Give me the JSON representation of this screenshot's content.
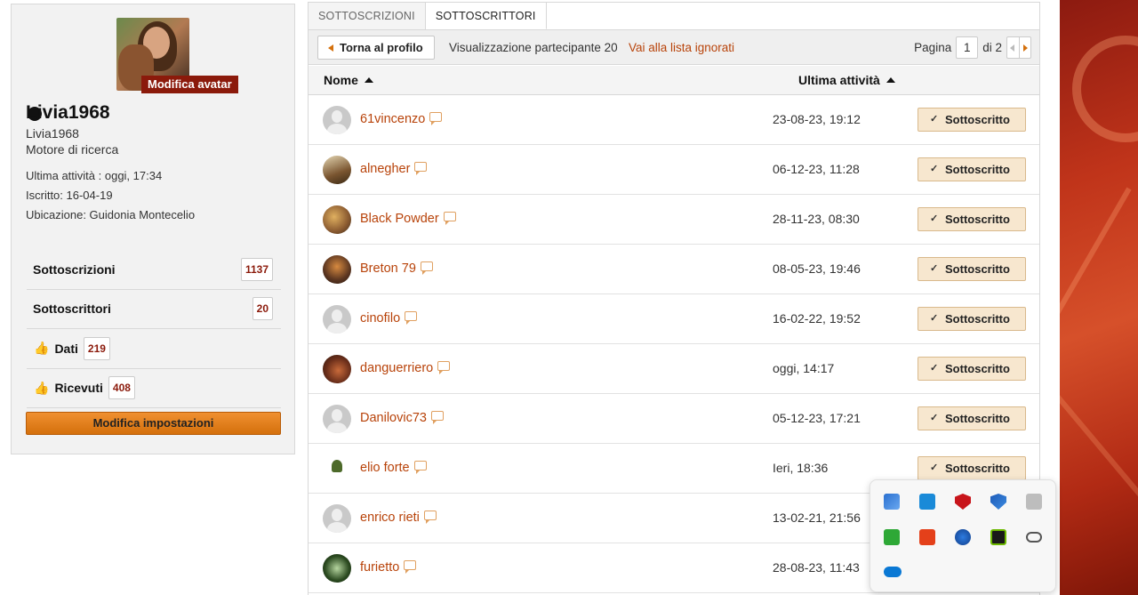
{
  "profile": {
    "edit_avatar": "Modifica avatar",
    "username_display": "Livia1968",
    "username": "Livia1968",
    "rank": "Motore di ricerca",
    "last_activity": "Ultima attività  : oggi, 17:34",
    "joined": "Iscritto: 16-04-19",
    "location": "Ubicazione: Guidonia Montecelio"
  },
  "stats": {
    "subscriptions_label": "Sottoscrizioni",
    "subscriptions_count": "1137",
    "subscribers_label": "Sottoscrittori",
    "subscribers_count": "20",
    "given_label": "Dati",
    "given_count": "219",
    "received_label": "Ricevuti",
    "received_count": "408",
    "settings_button": "Modifica impostazioni"
  },
  "tabs": [
    "SOTTOSCRIZIONI",
    "SOTTOSCRITTORI"
  ],
  "toolbar": {
    "back_button": "Torna al profilo",
    "viewing": "Visualizzazione partecipante 20",
    "ignored_link": "Vai alla lista ignorati",
    "page_label": "Pagina",
    "page_value": "1",
    "page_of": "di 2"
  },
  "table": {
    "col_name": "Nome",
    "col_activity": "Ultima attività",
    "rows": [
      {
        "name": "61vincenzo",
        "date": "23-08-23, 19:12",
        "status": "Sottoscritto"
      },
      {
        "name": "alnegher",
        "date": "06-12-23, 11:28",
        "status": "Sottoscritto"
      },
      {
        "name": "Black Powder",
        "date": "28-11-23, 08:30",
        "status": "Sottoscritto"
      },
      {
        "name": "Breton 79",
        "date": "08-05-23, 19:46",
        "status": "Sottoscritto"
      },
      {
        "name": "cinofilo",
        "date": "16-02-22, 19:52",
        "status": "Sottoscritto"
      },
      {
        "name": "danguerriero",
        "date": "oggi, 14:17",
        "status": "Sottoscritto"
      },
      {
        "name": "Danilovic73",
        "date": "05-12-23, 17:21",
        "status": "Sottoscritto"
      },
      {
        "name": "elio forte",
        "date": "Ieri, 18:36",
        "status": "Sottoscritto"
      },
      {
        "name": "enrico rieti",
        "date": "13-02-21, 21:56",
        "status": ""
      },
      {
        "name": "furietto",
        "date": "28-08-23, 11:43",
        "status": ""
      }
    ]
  },
  "tray_icons": [
    "security-icon",
    "monitor-icon",
    "mcafee-icon",
    "defender-icon",
    "usb-icon",
    "sync-icon",
    "ccleaner-icon",
    "network-icon",
    "nvidia-icon",
    "cloud-icon",
    "onedrive-icon"
  ]
}
